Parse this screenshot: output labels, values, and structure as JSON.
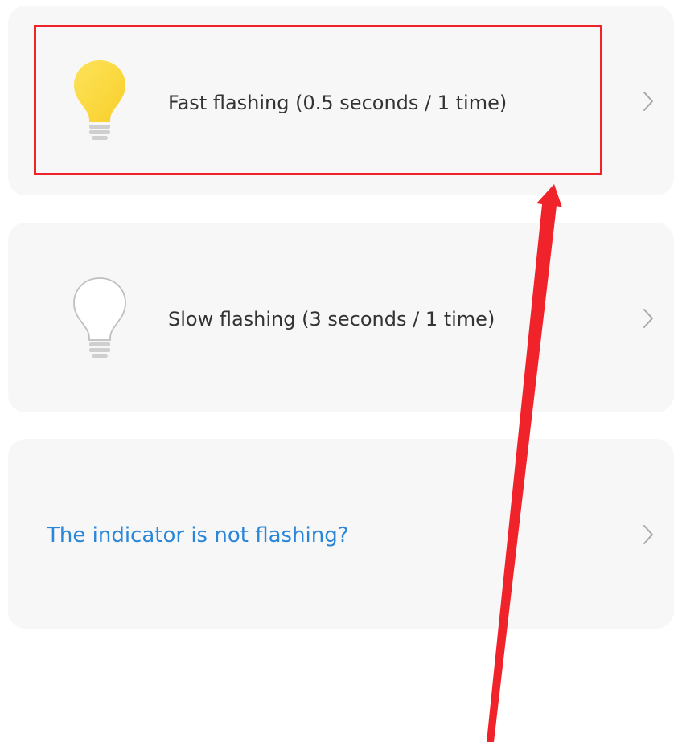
{
  "options": [
    {
      "label": "Fast flashing (0.5 seconds / 1 time)",
      "icon": "lightbulb-lit-icon",
      "icon_color": "#fdd93a"
    },
    {
      "label": "Slow flashing (3 seconds / 1 time)",
      "icon": "lightbulb-off-icon",
      "icon_color": "#ffffff"
    }
  ],
  "help_link": {
    "label": "The indicator is not flashing?",
    "color": "#2a86d8"
  },
  "annotation": {
    "highlight_color": "#f0222a",
    "arrow_icon": "arrow-up-icon"
  }
}
